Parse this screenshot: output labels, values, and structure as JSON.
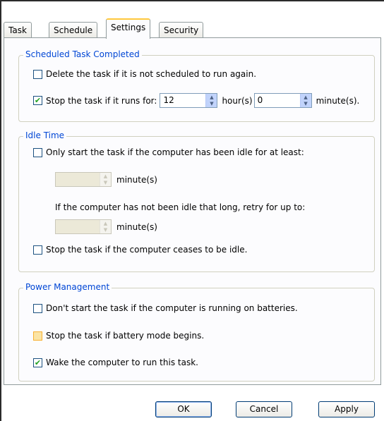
{
  "tabs": [
    {
      "label": "Task"
    },
    {
      "label": "Schedule"
    },
    {
      "label": "Settings",
      "active": true
    },
    {
      "label": "Security"
    }
  ],
  "scheduled_task_completed": {
    "title": "Scheduled Task Completed",
    "delete_if_not_scheduled": {
      "label": "Delete the task if it is not scheduled to run again.",
      "checked": false
    },
    "stop_if_runs_for": {
      "label": "Stop the task if it runs for:",
      "checked": true,
      "hours": "12",
      "hours_unit": "hour(s)",
      "minutes": "0",
      "minutes_unit": "minute(s)."
    }
  },
  "idle_time": {
    "title": "Idle Time",
    "only_start_if_idle": {
      "label": "Only start the task if the computer has been idle for at least:",
      "checked": false
    },
    "idle_minutes": {
      "value": "",
      "unit": "minute(s)"
    },
    "retry_text": "If the computer has not been idle that long, retry for up to:",
    "retry_minutes": {
      "value": "",
      "unit": "minute(s)"
    },
    "stop_if_ceases_idle": {
      "label": "Stop the task if the computer ceases to be idle.",
      "checked": false
    }
  },
  "power_management": {
    "title": "Power Management",
    "dont_start_on_batteries": {
      "label": "Don't start the task if the computer is running on batteries.",
      "checked": false
    },
    "stop_if_battery_mode": {
      "label": "Stop the task if battery mode begins.",
      "checked": false
    },
    "wake_to_run": {
      "label": "Wake the computer to run this task.",
      "checked": true
    }
  },
  "buttons": {
    "ok": "OK",
    "cancel": "Cancel",
    "apply": "Apply"
  },
  "colors": {
    "group_title": "#0046d5",
    "check_mark": "#21a121",
    "active_tab_accent": "#ffc83c"
  },
  "icons": {
    "check": "✔",
    "spin_up": "▲",
    "spin_down": "▼"
  }
}
